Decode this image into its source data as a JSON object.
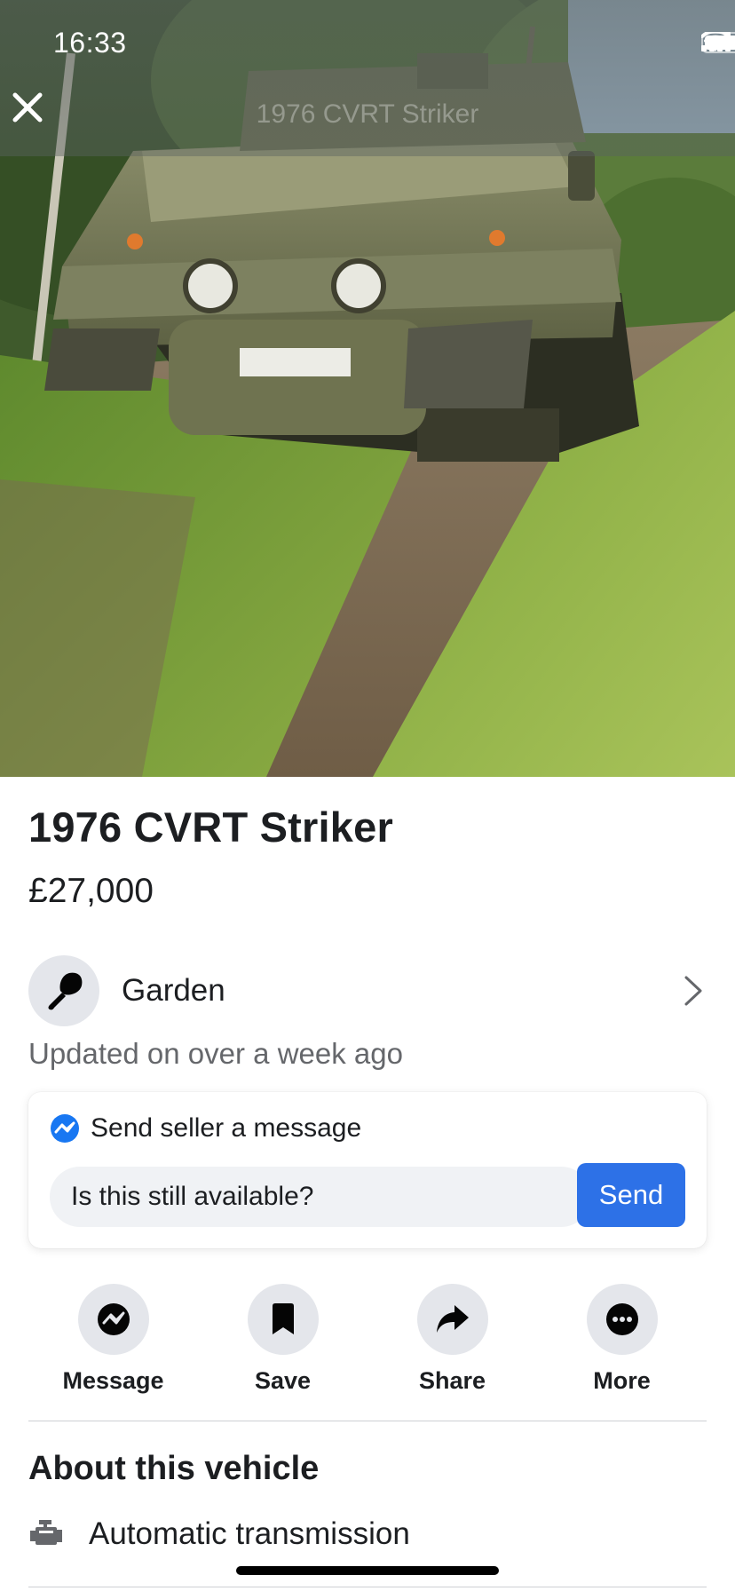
{
  "status_bar": {
    "time": "16:33"
  },
  "header": {
    "title_overlay": "1976 CVRT Striker"
  },
  "listing": {
    "title": "1976 CVRT Striker",
    "price": "£27,000",
    "category": "Garden",
    "updated": "Updated on over a week ago"
  },
  "message_box": {
    "heading": "Send seller a message",
    "input_value": "Is this still available?",
    "send_label": "Send"
  },
  "actions": [
    {
      "label": "Message",
      "icon": "messenger-icon"
    },
    {
      "label": "Save",
      "icon": "bookmark-icon"
    },
    {
      "label": "Share",
      "icon": "share-arrow-icon"
    },
    {
      "label": "More",
      "icon": "more-dots-icon"
    }
  ],
  "about": {
    "heading": "About this vehicle",
    "specs": [
      {
        "label": "Automatic transmission",
        "icon": "engine-icon"
      }
    ]
  },
  "colors": {
    "accent": "#2d71e7",
    "text": "#1c1e21",
    "secondary_text": "#65676b",
    "chip_bg": "#e4e6eb"
  }
}
